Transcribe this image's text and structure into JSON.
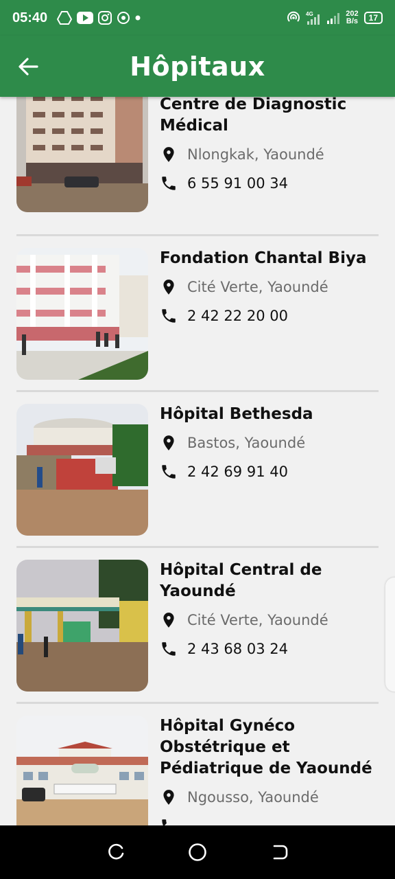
{
  "status_bar": {
    "time": "05:40",
    "network_speed_value": "202",
    "network_speed_unit": "B/s",
    "network_type": "4G",
    "battery": "17",
    "icons_left": [
      "drive-icon",
      "youtube-icon",
      "instagram-icon",
      "hotspot-icon",
      "dot-icon"
    ],
    "icons_right": [
      "hotspot-icon",
      "signal-4g-icon",
      "signal-icon",
      "battery-icon"
    ]
  },
  "app_bar": {
    "title": "Hôpitaux",
    "back_icon": "arrow-left-icon"
  },
  "hospitals": [
    {
      "name": "Centre de Diagnostic Médical",
      "location": "Nlongkak, Yaoundé",
      "phone": "6 55 91 00 34"
    },
    {
      "name": "Fondation Chantal Biya",
      "location": "Cité Verte, Yaoundé",
      "phone": "2 42 22 20 00"
    },
    {
      "name": "Hôpital Bethesda",
      "location": "Bastos, Yaoundé",
      "phone": "2 42 69 91 40"
    },
    {
      "name": "Hôpital Central de Yaoundé",
      "location": "Cité Verte, Yaoundé",
      "phone": "2 43 68 03 24"
    },
    {
      "name": "Hôpital Gynéco Obstétrique et Pédiatrique de Yaoundé",
      "location": "Ngousso, Yaoundé",
      "phone": ""
    }
  ],
  "colors": {
    "primary": "#2e8b4a",
    "background": "#f1f1f1",
    "divider": "#d9d9d9",
    "location_text": "#6b6b6b"
  },
  "nav_bar": {
    "icons": [
      "recents-icon",
      "home-icon",
      "back-icon"
    ]
  }
}
